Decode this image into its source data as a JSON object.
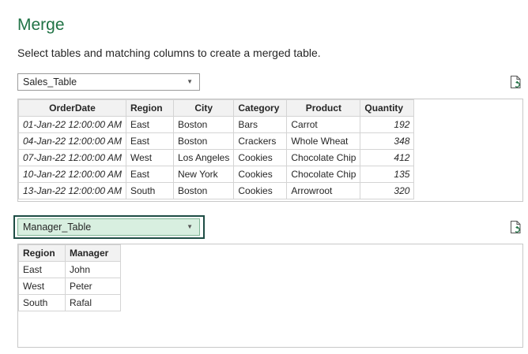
{
  "title": "Merge",
  "subtitle": "Select tables and matching columns to create a merged table.",
  "first_table": {
    "selected": "Sales_Table",
    "columns": [
      "OrderDate",
      "Region",
      "City",
      "Category",
      "Product",
      "Quantity"
    ],
    "rows": [
      [
        "01-Jan-22 12:00:00 AM",
        "East",
        "Boston",
        "Bars",
        "Carrot",
        "192"
      ],
      [
        "04-Jan-22 12:00:00 AM",
        "East",
        "Boston",
        "Crackers",
        "Whole Wheat",
        "348"
      ],
      [
        "07-Jan-22 12:00:00 AM",
        "West",
        "Los Angeles",
        "Cookies",
        "Chocolate Chip",
        "412"
      ],
      [
        "10-Jan-22 12:00:00 AM",
        "East",
        "New York",
        "Cookies",
        "Chocolate Chip",
        "135"
      ],
      [
        "13-Jan-22 12:00:00 AM",
        "South",
        "Boston",
        "Cookies",
        "Arrowroot",
        "320"
      ]
    ]
  },
  "second_table": {
    "selected": "Manager_Table",
    "columns": [
      "Region",
      "Manager"
    ],
    "rows": [
      [
        "East",
        "John"
      ],
      [
        "West",
        "Peter"
      ],
      [
        "South",
        "Rafal"
      ]
    ]
  },
  "icons": {
    "refresh": "refresh-preview-icon",
    "dropdown": "chevron-down-icon"
  },
  "colors": {
    "title": "#217346",
    "selected_dropdown_bg": "#d8efe0",
    "focus_ring": "#1e4d45"
  }
}
